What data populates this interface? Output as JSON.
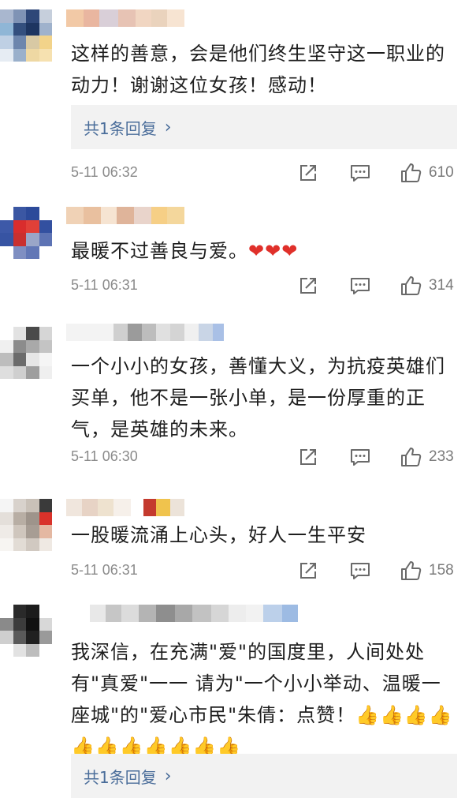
{
  "comments": [
    {
      "text": "这样的善意，会是他们终生坚守这一职业的动力！谢谢这位女孩！感动！",
      "reply_label": "共1条回复",
      "time": "5-11 06:32",
      "likes": "610"
    },
    {
      "text": "最暖不过善良与爱。",
      "emoji": "❤❤❤",
      "time": "5-11 06:31",
      "likes": "314"
    },
    {
      "text": "一个小小的女孩，善懂大义，为抗疫英雄们买单，他不是一张小单，是一份厚重的正气，是英雄的未来。",
      "time": "5-11 06:30",
      "likes": "233"
    },
    {
      "text": "一股暖流涌上心头，好人一生平安",
      "time": "5-11 06:31",
      "likes": "158"
    },
    {
      "text": "我深信，在充满\"爱\"的国度里，人间处处有\"真爱\"一一 请为\"一个小小举动、温暖一座城\"的\"爱心市民\"朱倩：点赞！👍👍👍👍👍👍👍👍👍👍👍",
      "reply_label": "共1条回复"
    }
  ],
  "icons": {
    "share": "share-icon",
    "comment": "comment-icon",
    "like": "thumbs-up-icon"
  },
  "colors": {
    "reply_link": "#4a6d9a",
    "reply_bg": "#f2f2f2",
    "meta_text": "#8a8a8a",
    "icon": "#6a6a6a",
    "heart": "#e0302a"
  }
}
